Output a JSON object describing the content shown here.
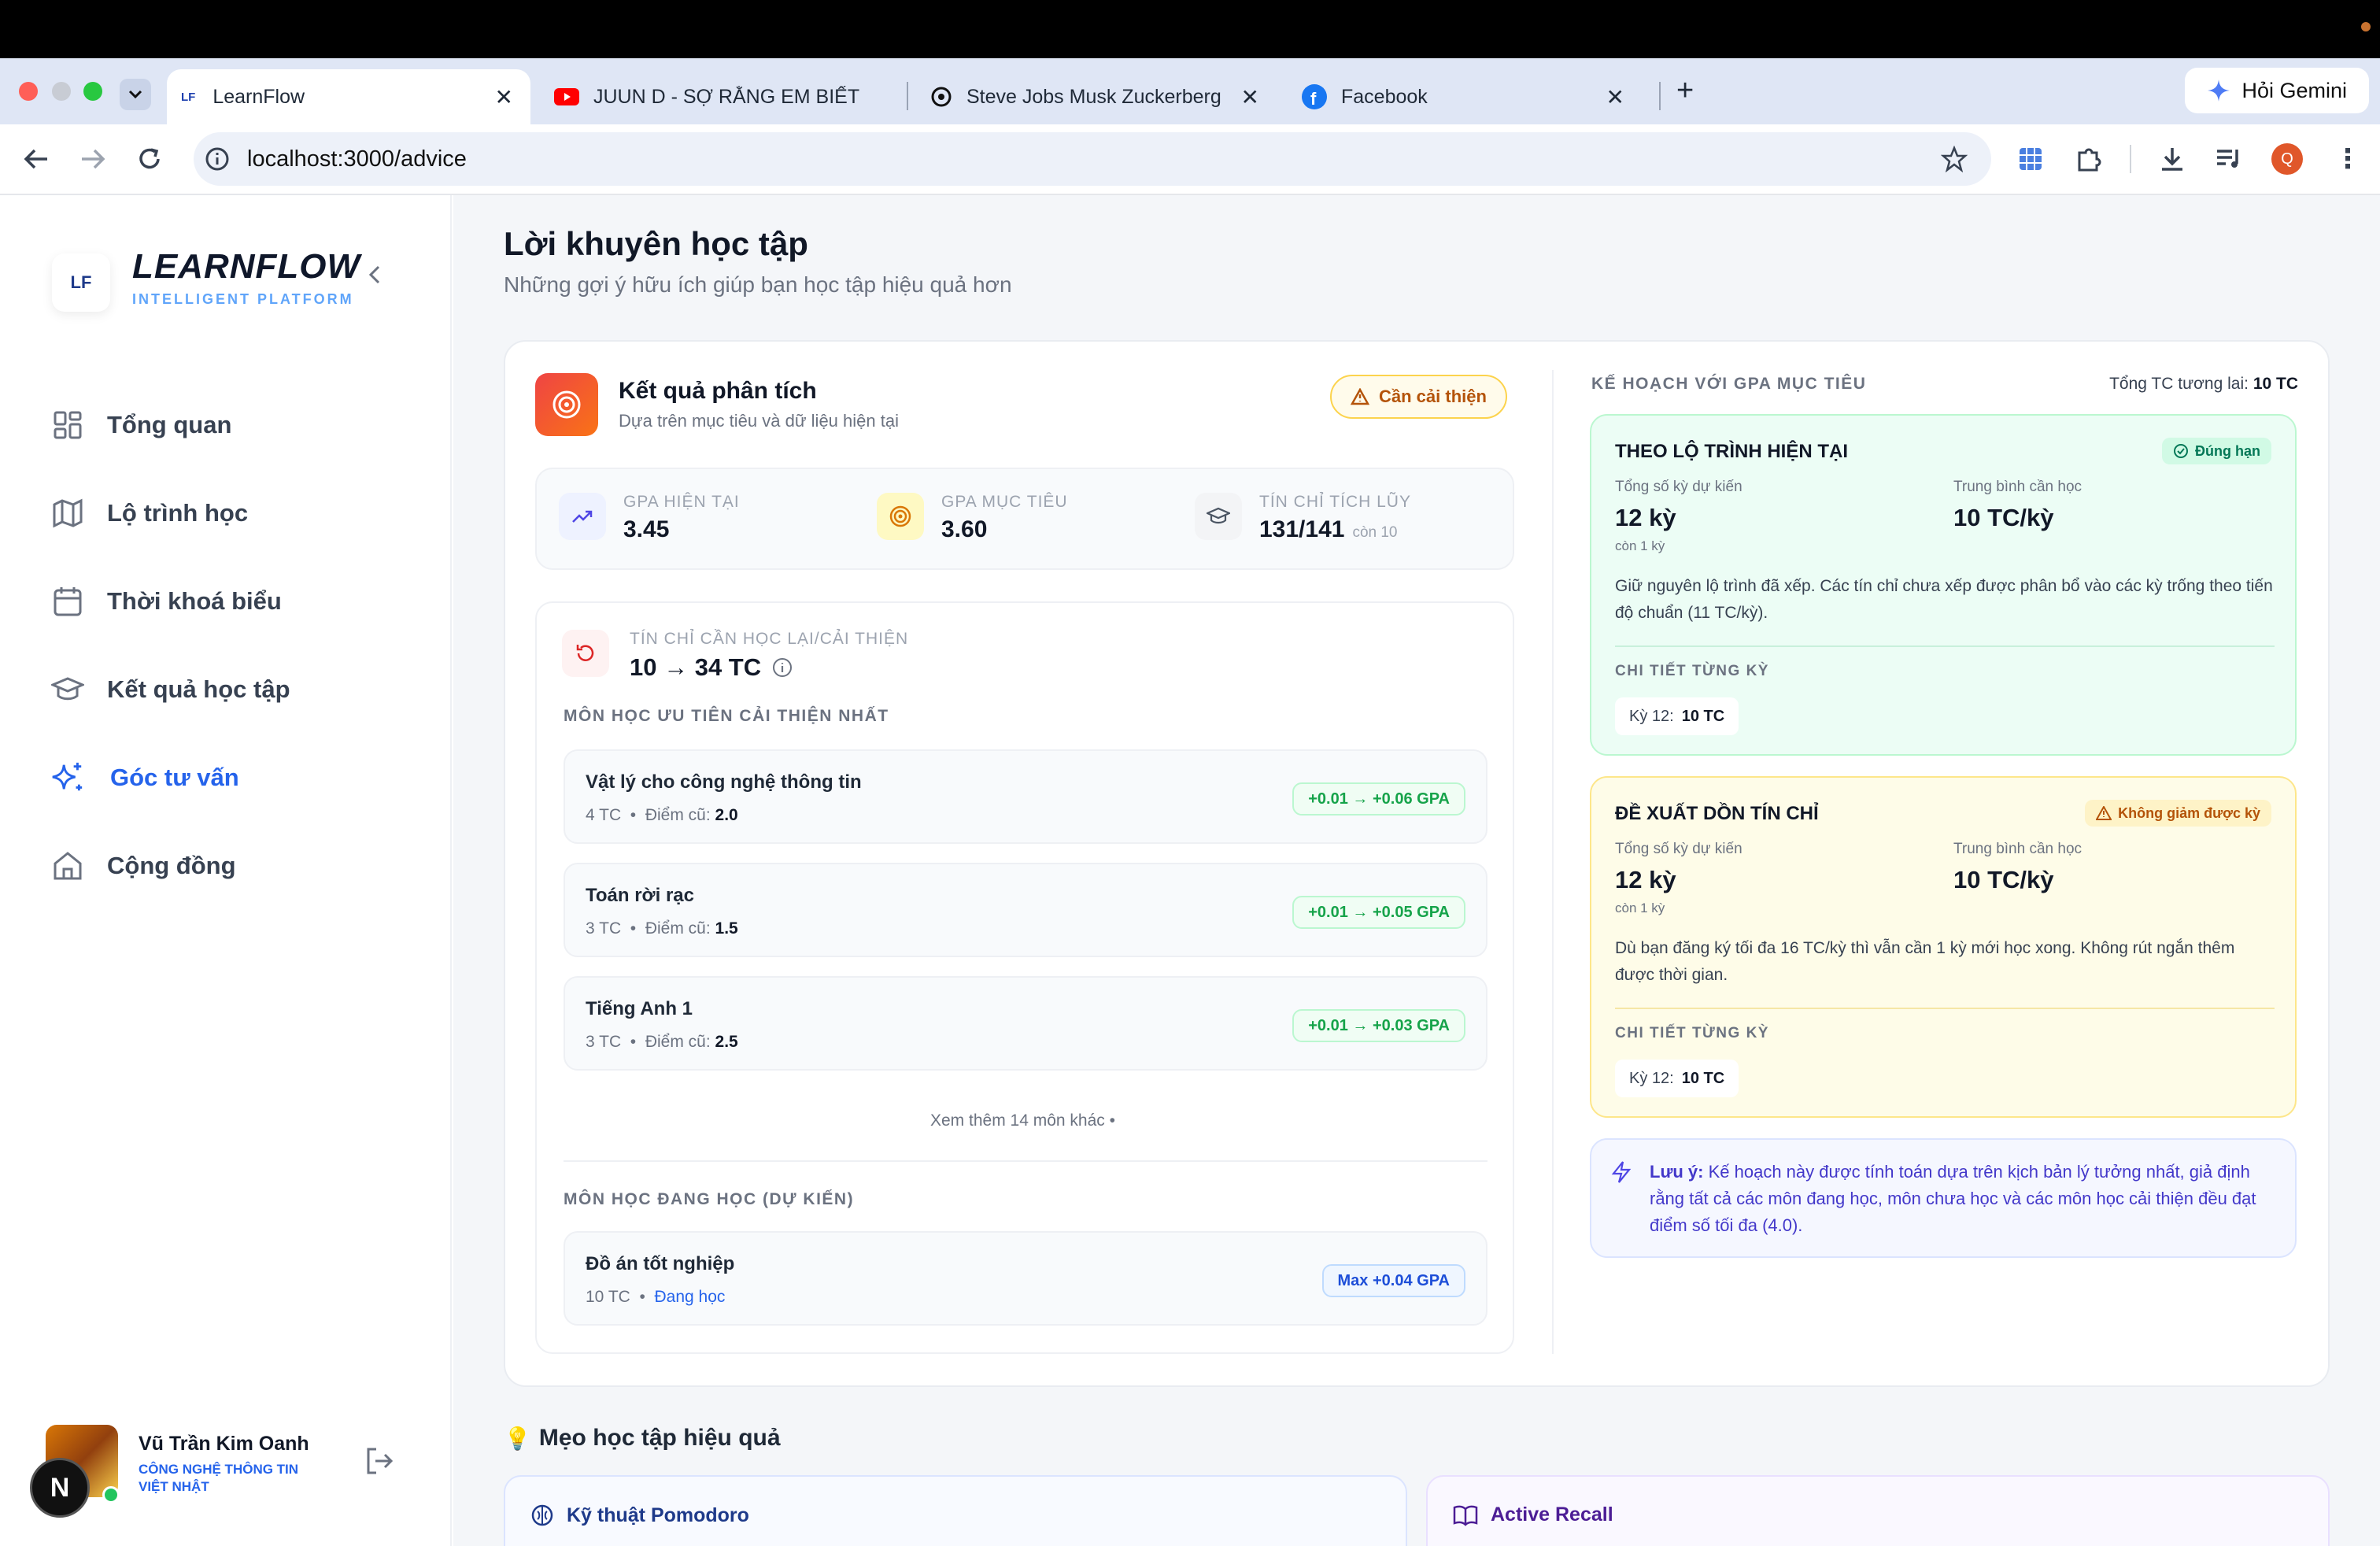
{
  "browser": {
    "tabs": [
      {
        "title": "LearnFlow",
        "favicon": "LF"
      },
      {
        "title": "JUUN D - SỢ RẰNG EM BIẾT",
        "favicon": "youtube-icon"
      },
      {
        "title": "Steve Jobs Musk Zuckerberg",
        "favicon": "openai-icon"
      },
      {
        "title": "Facebook",
        "favicon": "facebook-icon"
      }
    ],
    "gemini_label": "Hỏi Gemini",
    "url": "localhost:3000/advice",
    "profile_initial": "Q"
  },
  "sidebar": {
    "logo_mark": "LF",
    "brand": "LEARNFLOW",
    "brand_sub": "INTELLIGENT PLATFORM",
    "nav": [
      {
        "label": "Tổng quan",
        "icon": "dashboard-icon"
      },
      {
        "label": "Lộ trình học",
        "icon": "map-icon"
      },
      {
        "label": "Thời khoá biểu",
        "icon": "calendar-icon"
      },
      {
        "label": "Kết quả học tập",
        "icon": "graduation-cap-icon"
      },
      {
        "label": "Góc tư vấn",
        "icon": "sparkles-icon",
        "active": true
      },
      {
        "label": "Cộng đồng",
        "icon": "home-icon"
      }
    ],
    "user": {
      "name": "Vũ Trần Kim Oanh",
      "major": "CÔNG NGHỆ THÔNG TIN VIỆT NHẬT"
    },
    "next_badge": "N"
  },
  "page": {
    "title": "Lời khuyên học tập",
    "subtitle": "Những gợi ý hữu ích giúp bạn học tập hiệu quả hơn"
  },
  "analysis": {
    "title": "Kết quả phân tích",
    "subtitle": "Dựa trên mục tiêu và dữ liệu hiện tại",
    "status": "Cần cải thiện",
    "stats": [
      {
        "label": "GPA HIỆN TẠI",
        "value": "3.45",
        "extra": ""
      },
      {
        "label": "GPA MỤC TIÊU",
        "value": "3.60",
        "extra": ""
      },
      {
        "label": "TÍN CHỈ TÍCH LŨY",
        "value": "131/141",
        "extra": "còn 10"
      }
    ],
    "retake_label": "TÍN CHỈ CẦN HỌC LẠI/CẢI THIỆN",
    "retake_value": "10 → 34 TC",
    "priority_label": "MÔN HỌC ƯU TIÊN CẢI THIỆN NHẤT",
    "priority_courses": [
      {
        "name": "Vật lý cho công nghệ thông tin",
        "credits": "4 TC",
        "old_label": "Điểm cũ:",
        "old": "2.0",
        "gain": "+0.01 → +0.06 GPA"
      },
      {
        "name": "Toán rời rạc",
        "credits": "3 TC",
        "old_label": "Điểm cũ:",
        "old": "1.5",
        "gain": "+0.01 → +0.05 GPA"
      },
      {
        "name": "Tiếng Anh 1",
        "credits": "3 TC",
        "old_label": "Điểm cũ:",
        "old": "2.5",
        "gain": "+0.01 → +0.03 GPA"
      }
    ],
    "see_more": "Xem thêm 14 môn khác •",
    "current_label": "MÔN HỌC ĐANG HỌC (DỰ KIẾN)",
    "current_courses": [
      {
        "name": "Đồ án tốt nghiệp",
        "credits": "10 TC",
        "status": "Đang học",
        "gain": "Max +0.04 GPA"
      }
    ]
  },
  "plan": {
    "label": "KẾ HOẠCH VỚI GPA MỤC TIÊU",
    "total_label": "Tổng TC tương lai:",
    "total_value": "10 TC",
    "cards": [
      {
        "title": "THEO LỘ TRÌNH HIỆN TẠI",
        "badge": "Đúng hạn",
        "k1": "Tổng số kỳ dự kiến",
        "v1": "12 kỳ",
        "s1": "còn 1 kỳ",
        "k2": "Trung bình cần học",
        "v2": "10 TC/kỳ",
        "desc": "Giữ nguyên lộ trình đã xếp. Các tín chỉ chưa xếp được phân bổ vào các kỳ trống theo tiến độ chuẩn (11 TC/kỳ).",
        "detail_label": "CHI TIẾT TỪNG KỲ",
        "chip_term": "Kỳ 12:",
        "chip_value": "10 TC"
      },
      {
        "title": "ĐỀ XUẤT DỒN TÍN CHỈ",
        "badge": "Không giảm được kỳ",
        "k1": "Tổng số kỳ dự kiến",
        "v1": "12 kỳ",
        "s1": "còn 1 kỳ",
        "k2": "Trung bình cần học",
        "v2": "10 TC/kỳ",
        "desc": "Dù bạn đăng ký tối đa 16 TC/kỳ thì vẫn cần 1 kỳ mới học xong. Không rút ngắn thêm được thời gian.",
        "detail_label": "CHI TIẾT TỪNG KỲ",
        "chip_term": "Kỳ 12:",
        "chip_value": "10 TC"
      }
    ],
    "note_bold": "Lưu ý:",
    "note_text": "Kế hoạch này được tính toán dựa trên kịch bản lý tưởng nhất, giả định rằng tất cả các môn đang học, môn chưa học và các môn học cải thiện đều đạt điểm số tối đa (4.0)."
  },
  "tips": {
    "title": "Mẹo học tập hiệu quả",
    "items": [
      {
        "title": "Kỹ thuật Pomodoro",
        "color": "#1e3a8a"
      },
      {
        "title": "Active Recall",
        "color": "#4c1d95"
      }
    ]
  },
  "colors": {
    "accent": "#2563eb",
    "success": "#16a34a",
    "warning": "#b45309"
  }
}
